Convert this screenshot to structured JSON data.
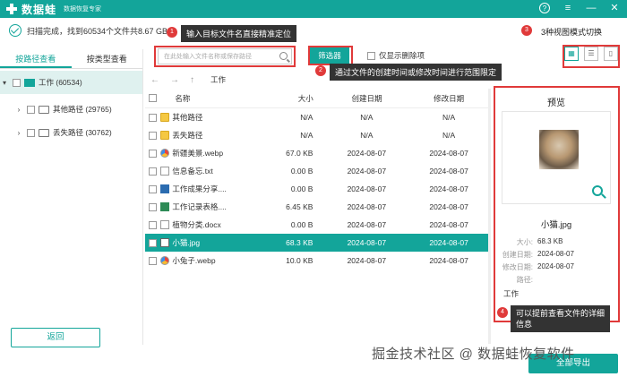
{
  "app": {
    "name": "数据蛙",
    "subtitle": "数据恢复专家",
    "help_glyph": "?",
    "menu_glyph": "≡",
    "minimize_glyph": "—",
    "close_glyph": "✕",
    "accent": "#13a59a"
  },
  "status": {
    "text": "扫描完成，找到60534个文件共8.67 GB"
  },
  "callouts": {
    "c1": {
      "num": "1",
      "text": "输入目标文件名直接精准定位"
    },
    "c2": {
      "num": "2",
      "text": "通过文件的创建时间或修改时间进行范围限定"
    },
    "c3": {
      "num": "3",
      "text": "3种视图模式切换"
    },
    "c4": {
      "num": "4",
      "text": "可以提前查看文件的详细\n信息"
    }
  },
  "left": {
    "tabs": [
      "按路径查看",
      "按类型查看"
    ],
    "tree": [
      {
        "label": "工作 (60534)",
        "expanded": true
      },
      {
        "label": "其他路径 (29765)",
        "expanded": false
      },
      {
        "label": "丢失路径 (30762)",
        "expanded": false
      }
    ]
  },
  "toolbar": {
    "search_placeholder": "在此处输入文件名称或保存路径",
    "filter_label": "筛选器",
    "show_deleted_label": "仅显示删除项",
    "view_modes": [
      "▦",
      "☰",
      "▯"
    ]
  },
  "path": {
    "back": "←",
    "forward": "→",
    "up": "↑",
    "current": "工作"
  },
  "table": {
    "headers": [
      "名称",
      "大小",
      "创建日期",
      "修改日期"
    ],
    "rows": [
      {
        "icon": "folder",
        "name": "其他路径",
        "size": "N/A",
        "created": "N/A",
        "modified": "N/A"
      },
      {
        "icon": "folder",
        "name": "丢失路径",
        "size": "N/A",
        "created": "N/A",
        "modified": "N/A"
      },
      {
        "icon": "web",
        "name": "新疆美景.webp",
        "size": "67.0 KB",
        "created": "2024-08-07",
        "modified": "2024-08-07"
      },
      {
        "icon": "txt",
        "name": "信息备忘.txt",
        "size": "0.00  B",
        "created": "2024-08-07",
        "modified": "2024-08-07"
      },
      {
        "icon": "doc",
        "name": "工作成果分享....",
        "size": "0.00  B",
        "created": "2024-08-07",
        "modified": "2024-08-07"
      },
      {
        "icon": "xls",
        "name": "工作记录表格....",
        "size": "6.45 KB",
        "created": "2024-08-07",
        "modified": "2024-08-07"
      },
      {
        "icon": "txt",
        "name": "植物分类.docx",
        "size": "0.00  B",
        "created": "2024-08-07",
        "modified": "2024-08-07"
      },
      {
        "icon": "jpg",
        "name": "小猫.jpg",
        "size": "68.3 KB",
        "created": "2024-08-07",
        "modified": "2024-08-07",
        "selected": true
      },
      {
        "icon": "web",
        "name": "小兔子.webp",
        "size": "10.0 KB",
        "created": "2024-08-07",
        "modified": "2024-08-07"
      }
    ]
  },
  "preview": {
    "title": "预览",
    "file_name": "小猫.jpg",
    "size_label": "大小:",
    "size_value": "68.3 KB",
    "created_label": "创建日期:",
    "created_value": "2024-08-07",
    "modified_label": "修改日期:",
    "modified_value": "2024-08-07",
    "path_label": "路径:",
    "path_value": "工作"
  },
  "footer": {
    "back_label": "返回",
    "export_label": "全部导出",
    "watermark": "掘金技术社区 @ 数据蛙恢复软件"
  }
}
